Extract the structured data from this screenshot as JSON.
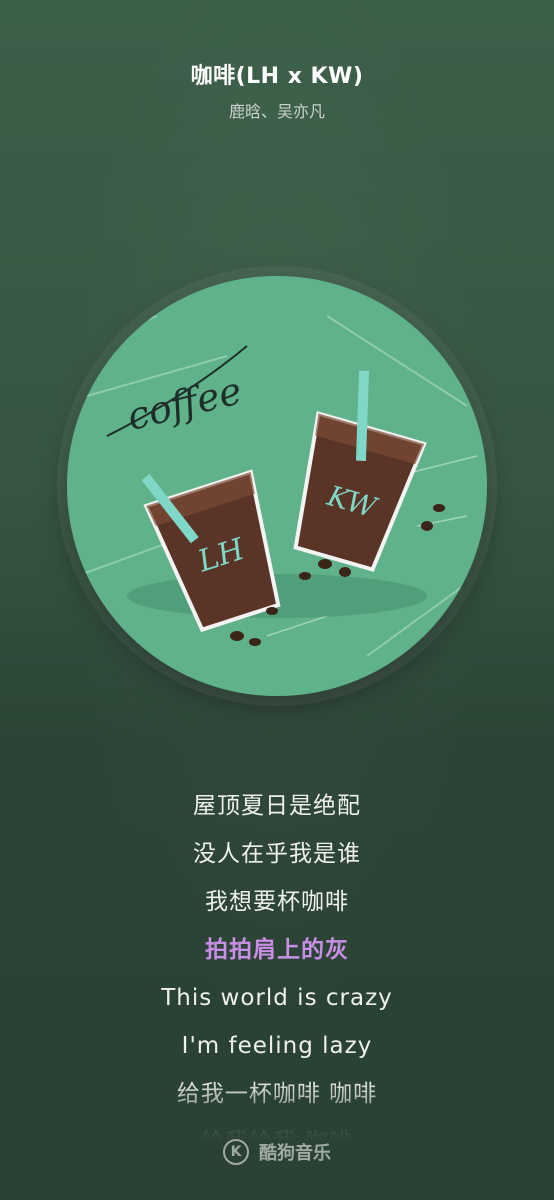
{
  "song": {
    "title": "咖啡(LH x KW)",
    "artist": "鹿晗、吴亦凡"
  },
  "album_art": {
    "script_text": "coffee",
    "cup_left_label": "LH",
    "cup_right_label": "KW",
    "background_color": "#5fb28a"
  },
  "lyrics": [
    "屋顶夏日是绝配",
    "没人在乎我是谁",
    "我想要杯咖啡",
    "拍拍肩上的灰",
    "This world is crazy",
    "I'm feeling lazy",
    "给我一杯咖啡  咖啡",
    "给我给我  咖啡"
  ],
  "active_lyric_index": 3,
  "colors": {
    "active_lyric": "#c98ee6",
    "background": "#3a5a45"
  },
  "watermark": {
    "logo_letter": "K",
    "text": "酷狗音乐",
    "logo_icon": "kugou-logo-icon"
  }
}
